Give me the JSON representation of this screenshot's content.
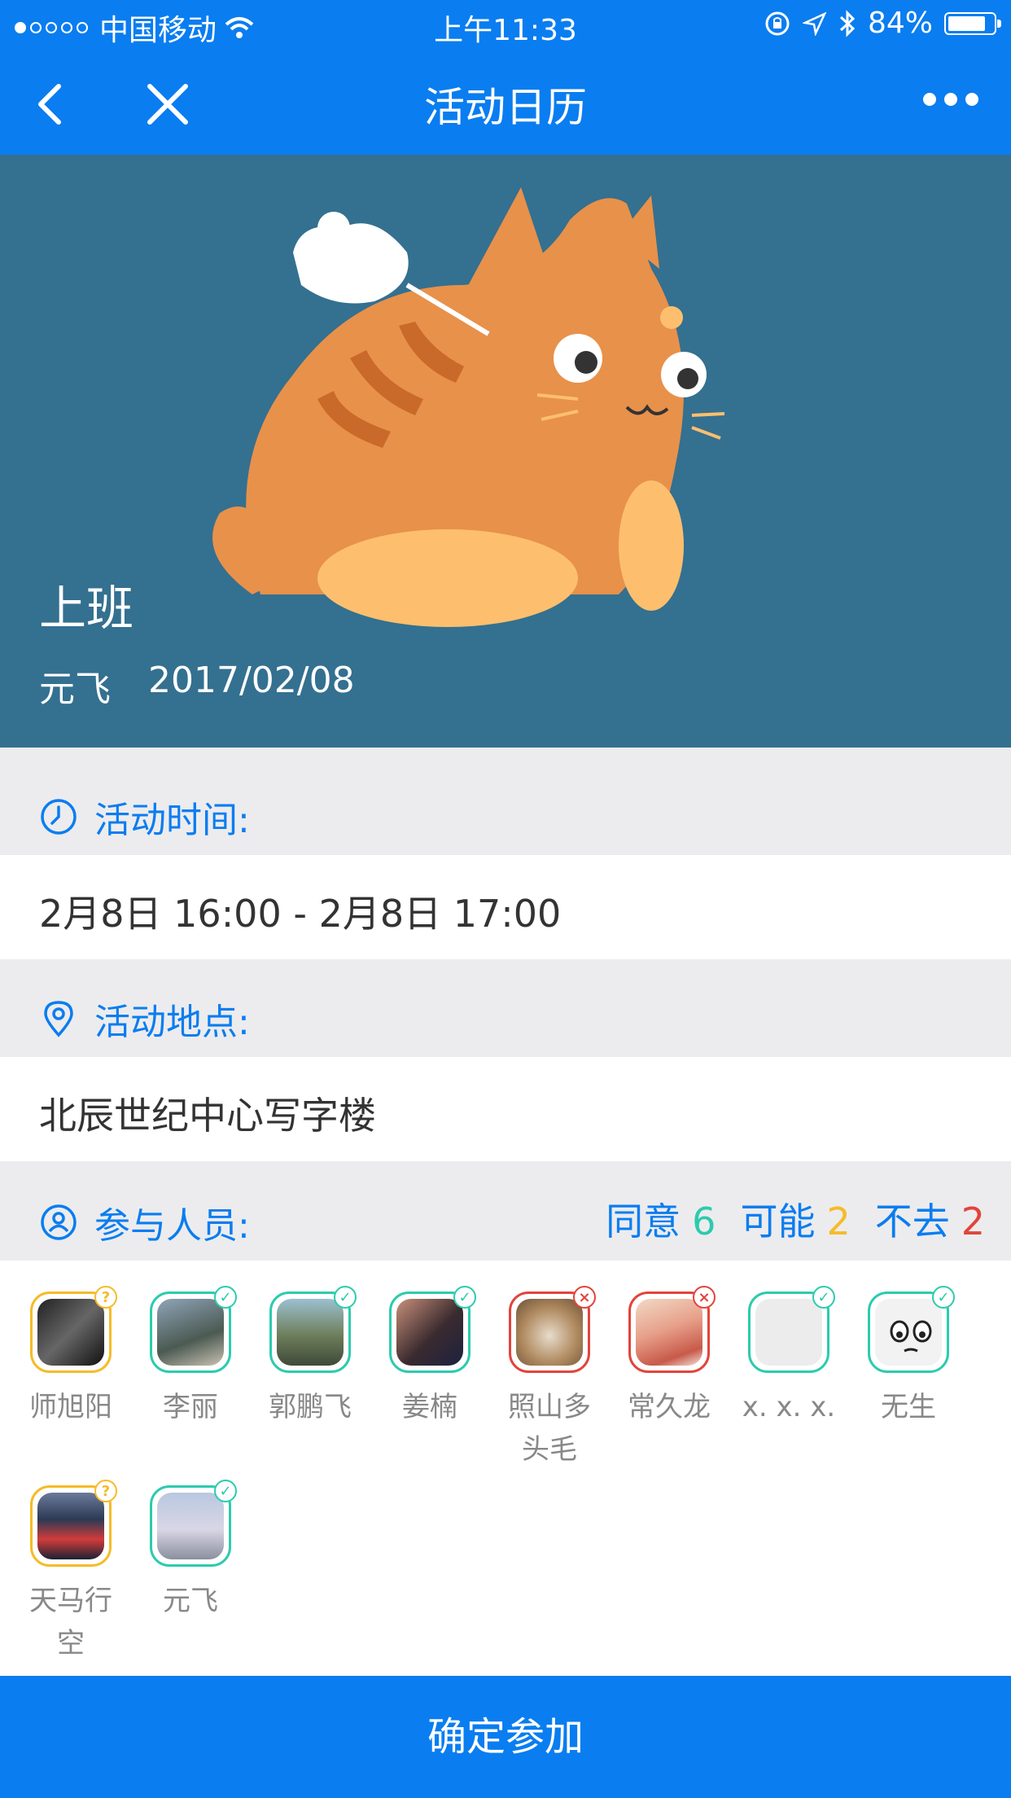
{
  "status_bar": {
    "carrier": "中国移动",
    "time": "上午11:33",
    "battery": "84%",
    "battery_level": 0.84
  },
  "nav": {
    "title": "活动日历"
  },
  "hero": {
    "title": "上班",
    "author": "元飞",
    "date": "2017/02/08"
  },
  "time_section": {
    "label": "活动时间:",
    "value": "2月8日 16:00 - 2月8日 17:00"
  },
  "place_section": {
    "label": "活动地点:",
    "value": "北辰世纪中心写字楼"
  },
  "participants": {
    "label": "参与人员:",
    "agree_label": "同意",
    "agree_count": "6",
    "maybe_label": "可能",
    "maybe_count": "2",
    "decline_label": "不去",
    "decline_count": "2",
    "people": [
      {
        "name": "师旭阳",
        "status": "maybe"
      },
      {
        "name": "李丽",
        "status": "agree"
      },
      {
        "name": "郭鹏飞",
        "status": "agree"
      },
      {
        "name": "姜楠",
        "status": "agree"
      },
      {
        "name": "照山多头毛",
        "status": "decline"
      },
      {
        "name": "常久龙",
        "status": "decline"
      },
      {
        "name": "x. x. x.",
        "status": "agree"
      },
      {
        "name": "无生",
        "status": "agree"
      },
      {
        "name": "天马行空",
        "status": "maybe"
      },
      {
        "name": "元飞",
        "status": "agree"
      }
    ]
  },
  "footer": {
    "confirm_label": "确定参加"
  },
  "colors": {
    "primary": "#0a7df0",
    "agree": "#2ccbae",
    "maybe": "#f6bb27",
    "decline": "#e2443b",
    "hero_bg": "#347090"
  }
}
